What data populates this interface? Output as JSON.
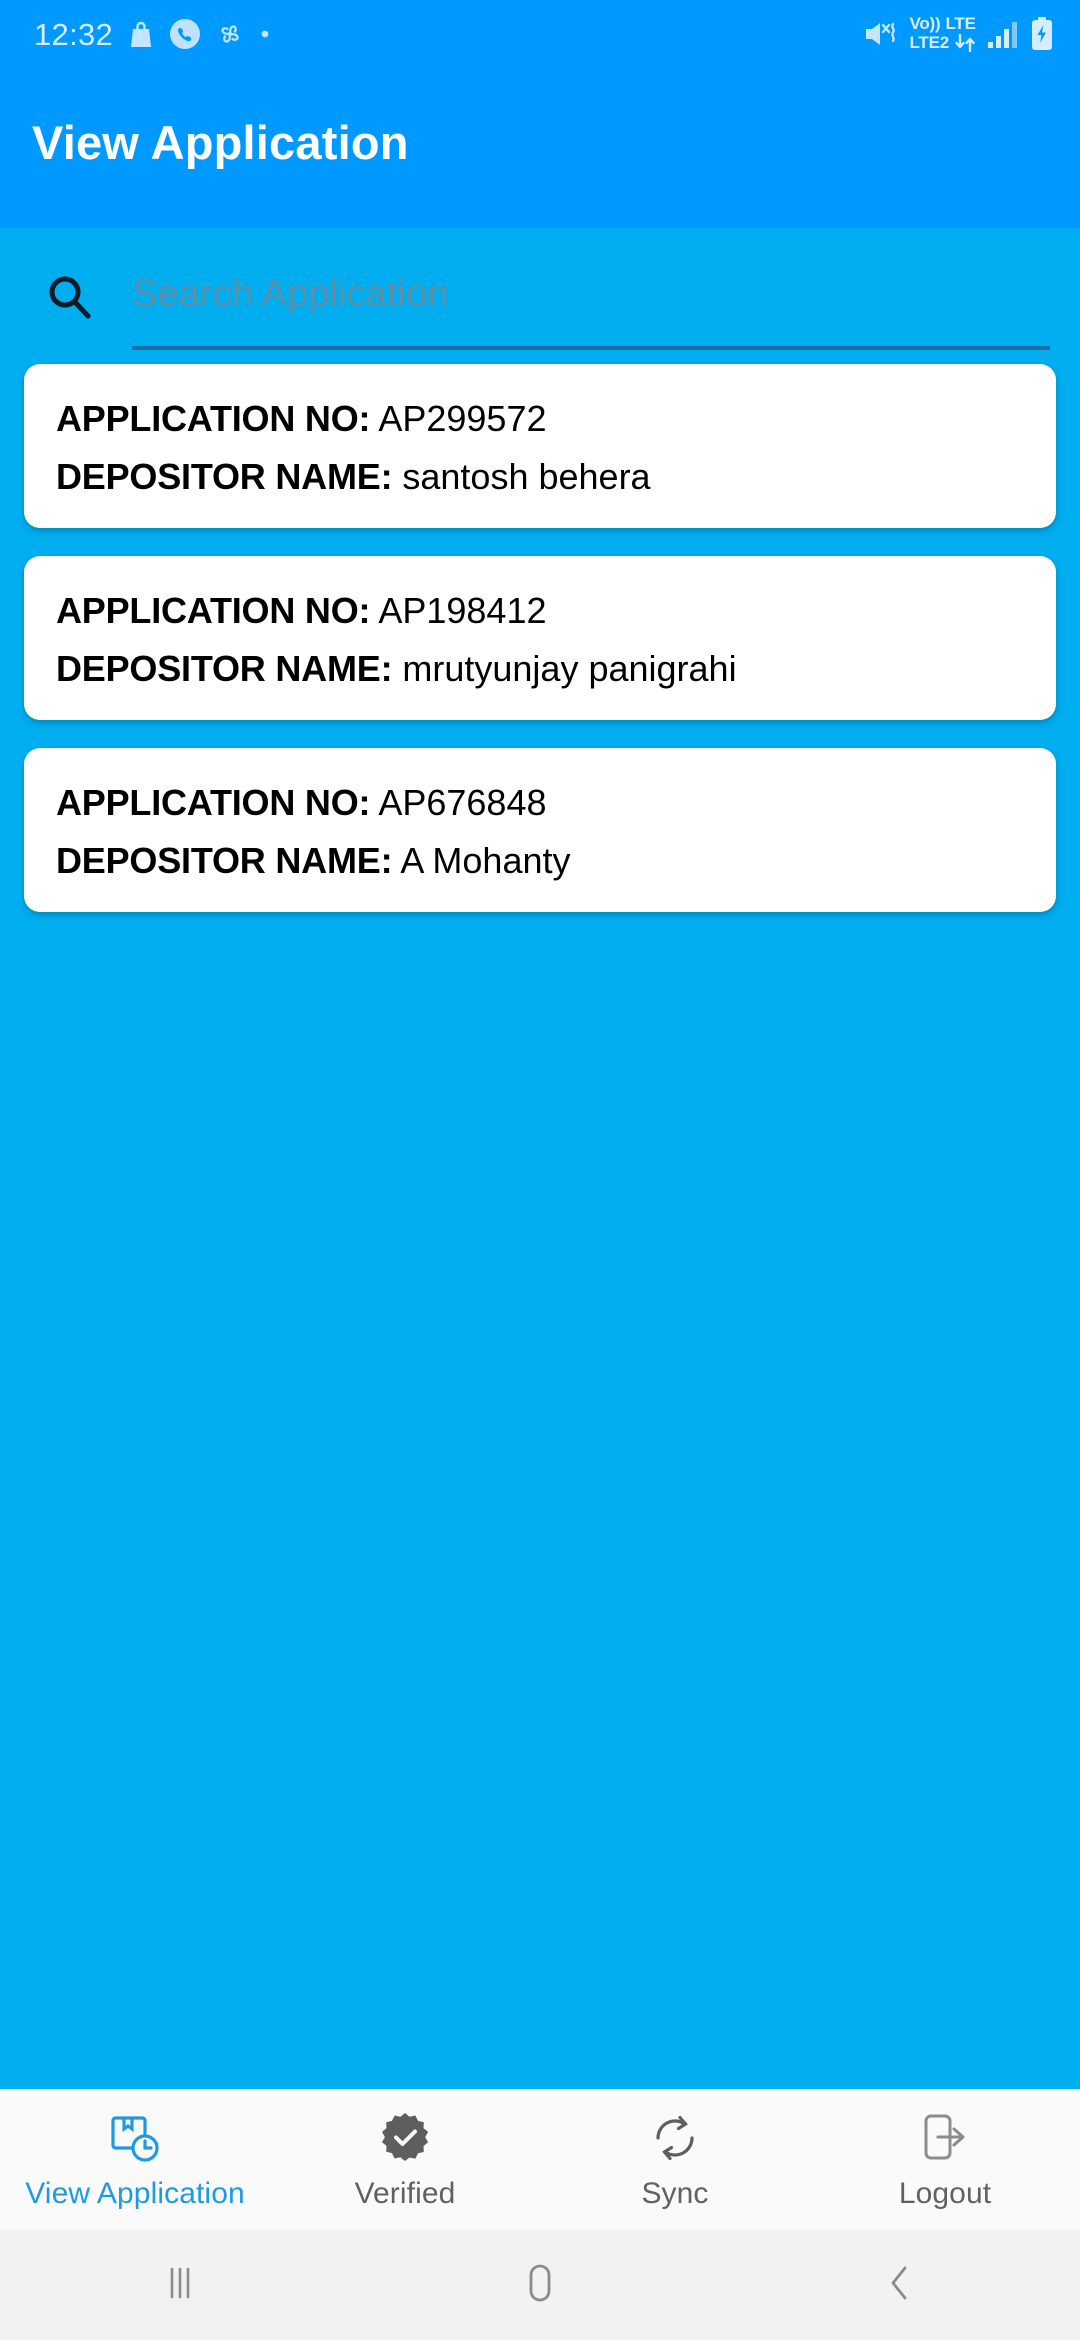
{
  "status_bar": {
    "time": "12:32",
    "left_icons": [
      "shopping-bag-icon",
      "phone-circle-icon",
      "pinwheel-icon",
      "dot-icon"
    ],
    "network": {
      "volte": "Vo))",
      "lte": "LTE",
      "sim2": "LTE2"
    },
    "right_icons": [
      "mute-vibrate-icon",
      "data-transfer-icon",
      "signal-bars-icon",
      "battery-charging-icon"
    ]
  },
  "app_bar": {
    "title": "View Application"
  },
  "search": {
    "icon": "search-icon",
    "value": "",
    "placeholder": "Search Application"
  },
  "list": {
    "labels": {
      "application_no": "APPLICATION NO:",
      "depositor_name": "DEPOSITOR NAME:"
    },
    "items": [
      {
        "application_no": "AP299572",
        "depositor_name": "santosh behera"
      },
      {
        "application_no": "AP198412",
        "depositor_name": "mrutyunjay panigrahi"
      },
      {
        "application_no": "AP676848",
        "depositor_name": "A Mohanty"
      }
    ]
  },
  "bottom_nav": {
    "active_index": 0,
    "items": [
      {
        "label": "View Application",
        "icon": "package-clock-icon"
      },
      {
        "label": "Verified",
        "icon": "verified-badge-icon"
      },
      {
        "label": "Sync",
        "icon": "sync-refresh-icon"
      },
      {
        "label": "Logout",
        "icon": "logout-door-icon"
      }
    ]
  },
  "system_nav": {
    "items": [
      {
        "name": "recents-button",
        "icon": "recents-bars-icon"
      },
      {
        "name": "home-button",
        "icon": "home-rounded-square-icon"
      },
      {
        "name": "back-button",
        "icon": "back-chevron-icon"
      }
    ]
  },
  "colors": {
    "app_bar": "#0099FF",
    "body": "#00ADEE",
    "card": "#FFFFFF",
    "accent": "#1E9BE0",
    "nav_inactive": "#616161",
    "placeholder": "#5E8FA8",
    "underline": "#1E6FA8"
  }
}
